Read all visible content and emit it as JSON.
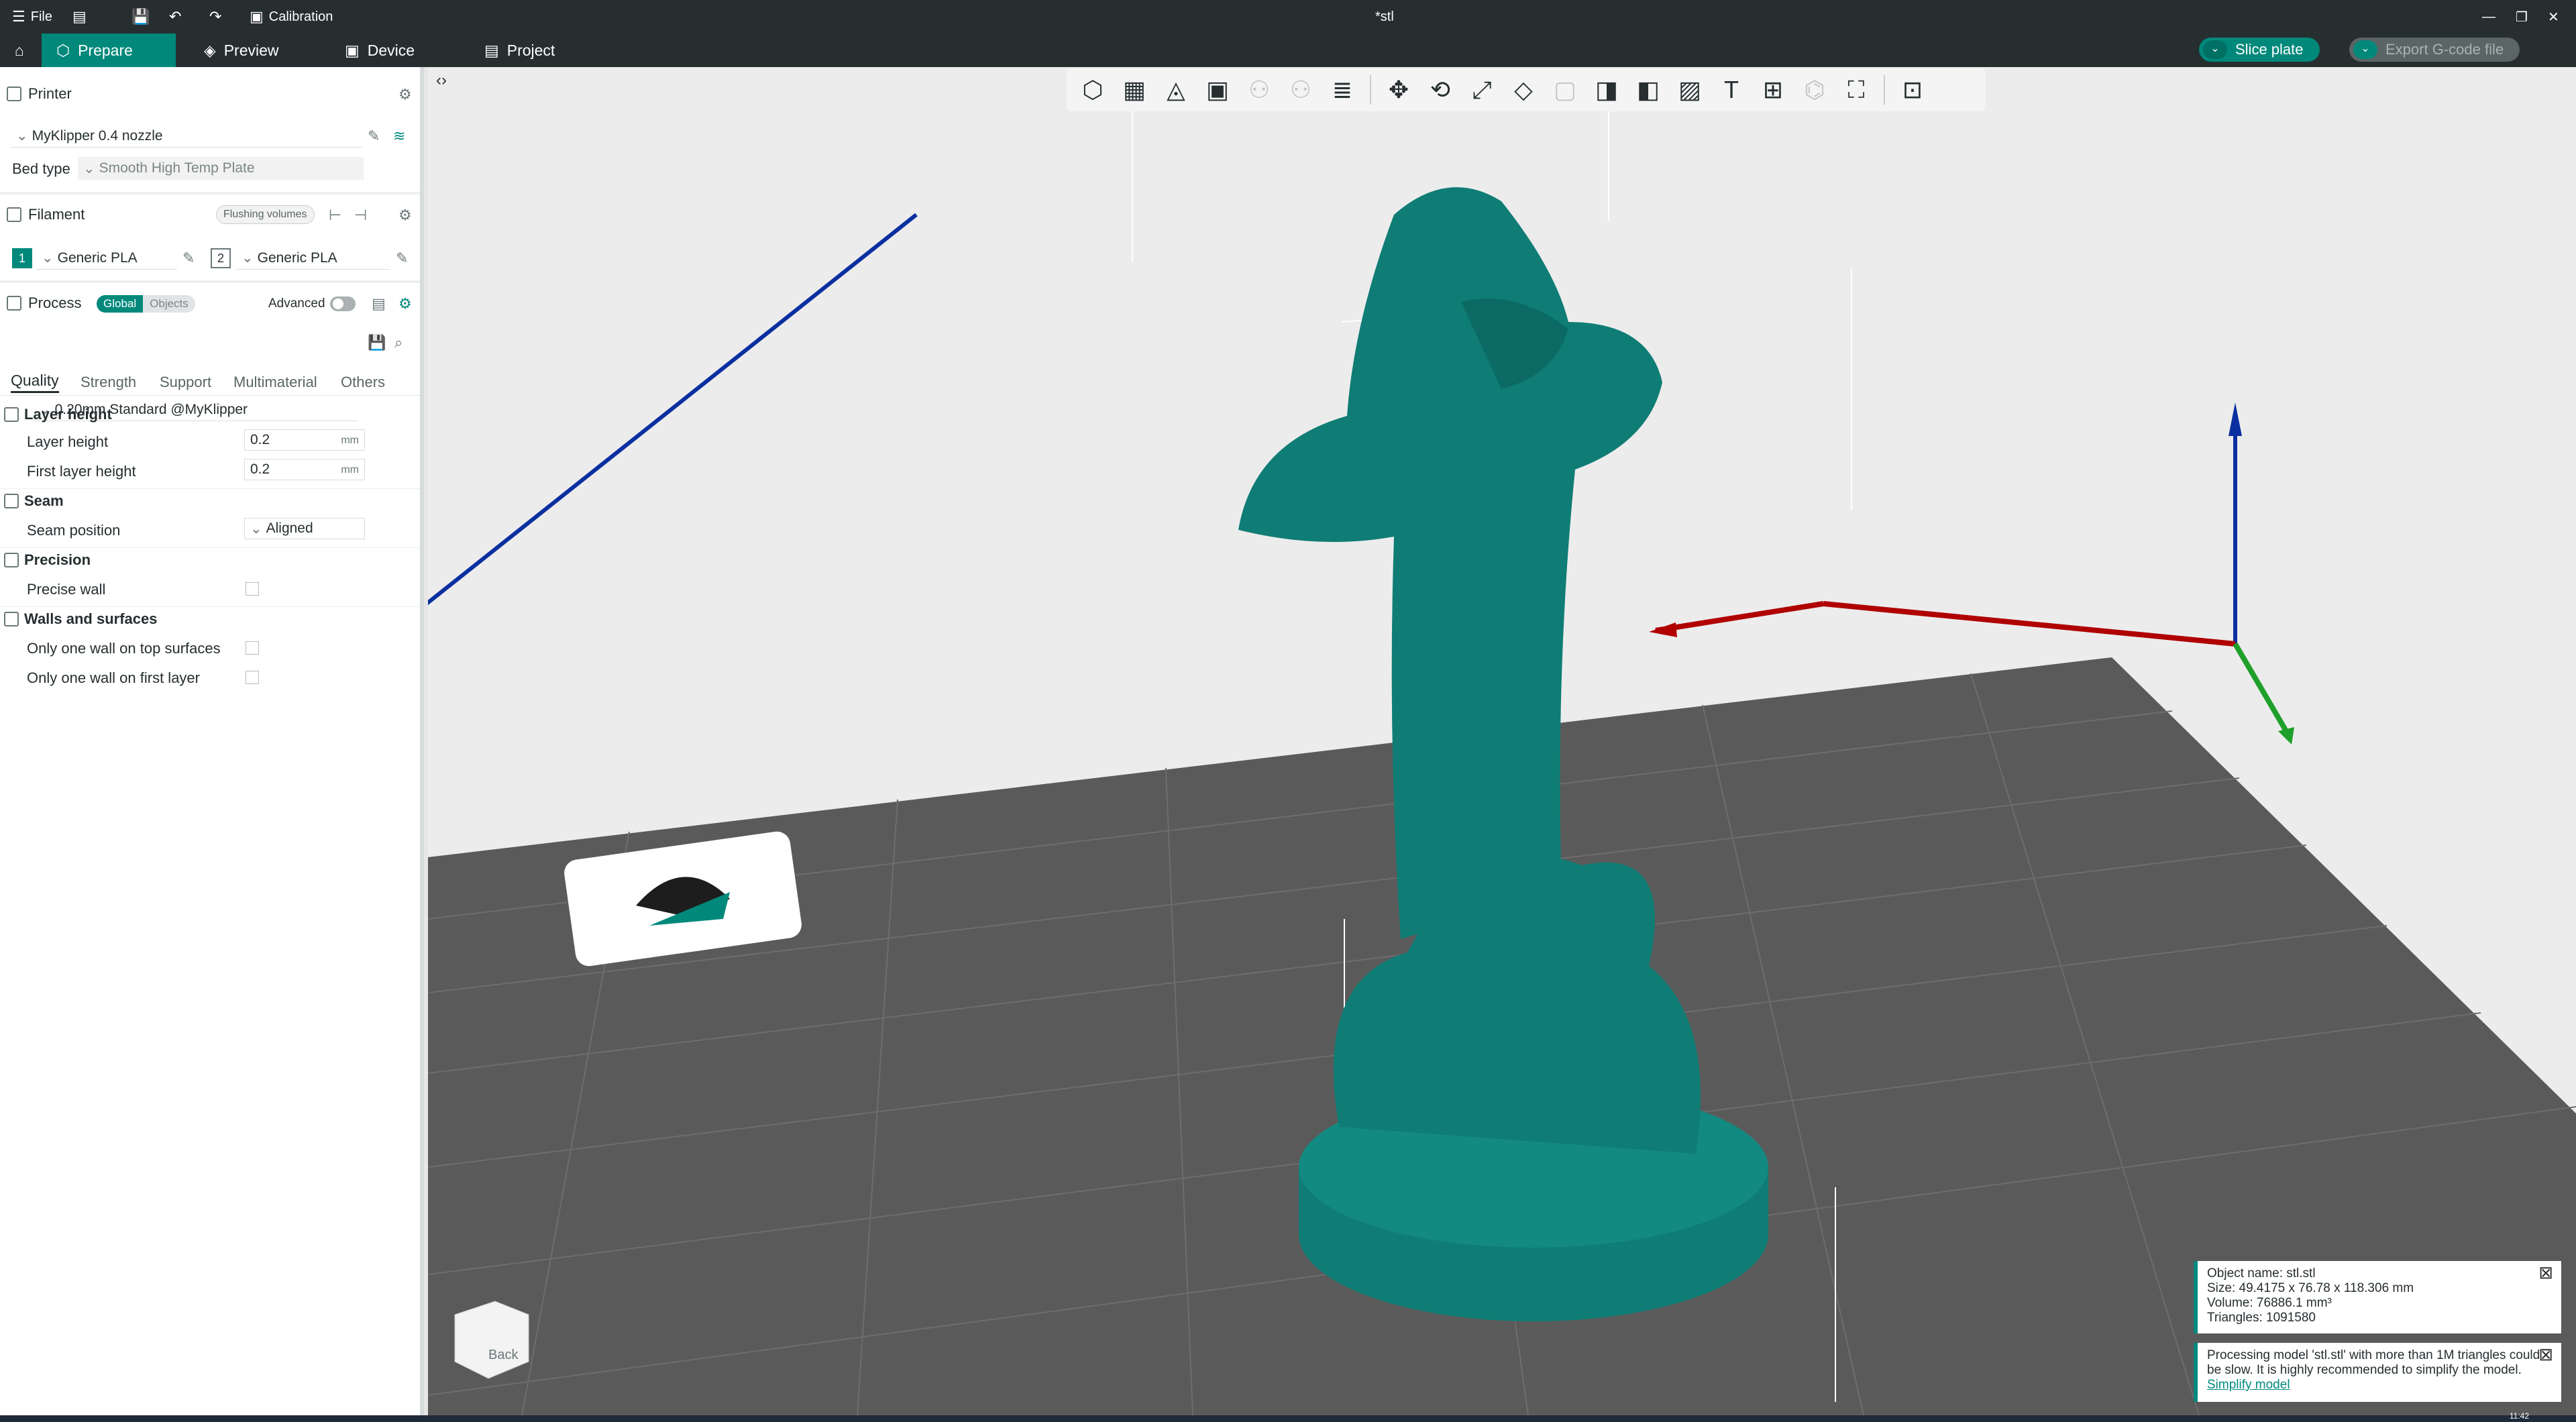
{
  "titlebar": {
    "file_label": "File",
    "calibration_label": "Calibration",
    "document_title": "*stl"
  },
  "tabs": [
    {
      "label": "Prepare",
      "icon": "cube-icon"
    },
    {
      "label": "Preview",
      "icon": "layers-icon"
    },
    {
      "label": "Device",
      "icon": "device-icon"
    },
    {
      "label": "Project",
      "icon": "project-icon"
    }
  ],
  "actions": {
    "slice_label": "Slice plate",
    "export_label": "Export G-code file"
  },
  "printer": {
    "section_label": "Printer",
    "name": "MyKlipper 0.4 nozzle",
    "bed_type_label": "Bed type",
    "bed_type_value": "Smooth High Temp Plate"
  },
  "filament": {
    "section_label": "Filament",
    "flushing_label": "Flushing volumes",
    "slots": [
      {
        "index": "1",
        "name": "Generic PLA"
      },
      {
        "index": "2",
        "name": "Generic PLA"
      }
    ]
  },
  "process": {
    "section_label": "Process",
    "global_label": "Global",
    "objects_label": "Objects",
    "advanced_label": "Advanced",
    "preset": "0.20mm Standard @MyKlipper"
  },
  "settings_tabs": [
    "Quality",
    "Strength",
    "Support",
    "Multimaterial",
    "Others"
  ],
  "quality": {
    "layer_height_group": "Layer height",
    "layer_height_label": "Layer height",
    "layer_height_value": "0.2",
    "first_layer_label": "First layer height",
    "first_layer_value": "0.2",
    "unit": "mm",
    "seam_group": "Seam",
    "seam_position_label": "Seam position",
    "seam_position_value": "Aligned",
    "precision_group": "Precision",
    "precise_wall_label": "Precise wall",
    "walls_group": "Walls and surfaces",
    "one_wall_top_label": "Only one wall on top surfaces",
    "one_wall_first_label": "Only one wall on first layer"
  },
  "viewcube_label": "Back",
  "object_info": {
    "name": "Object name: stl.stl",
    "size": "Size: 49.4175 x 76.78 x 118.306 mm",
    "volume": "Volume: 76886.1 mm³",
    "triangles": "Triangles: 1091580"
  },
  "warning": {
    "text": "Processing model 'stl.stl' with more than 1M triangles could be slow. It is highly recommended to simplify the model.",
    "link": "Simplify model"
  },
  "clock": "11:42",
  "colors": {
    "accent": "#00897b",
    "model": "#0f7d75",
    "bed": "#5a5a5a",
    "axis_x": "#b00000",
    "axis_y": "#1fa02a",
    "axis_z": "#0a2fa0"
  }
}
